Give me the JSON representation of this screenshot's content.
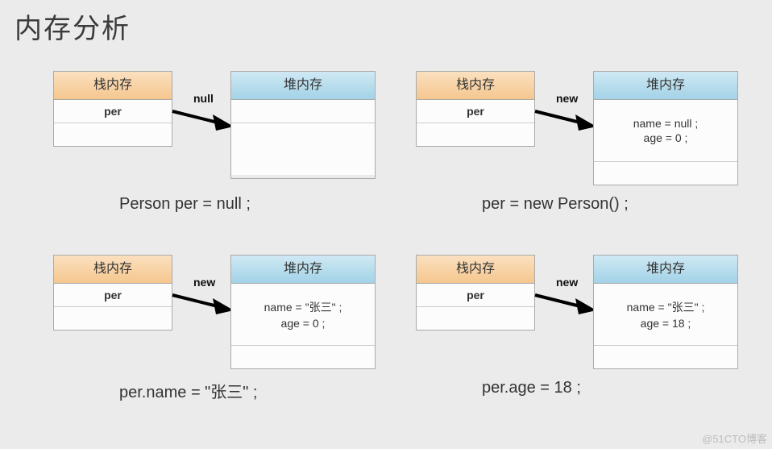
{
  "title": "内存分析",
  "stackHeader": "栈内存",
  "heapHeader": "堆内存",
  "per": "per",
  "empty": "",
  "labels": {
    "null": "null",
    "new": "new"
  },
  "heap": {
    "empty": "",
    "name_null": "name = null ;",
    "age_0": "age = 0 ;",
    "name_zhang": "name = \"张三\" ;",
    "age_18": "age = 18 ;"
  },
  "captions": {
    "c1": "Person per = null ;",
    "c2": "per = new Person() ;",
    "c3": "per.name = \"张三\" ;",
    "c4": "per.age = 18 ;"
  },
  "watermark": "@51CTO博客"
}
